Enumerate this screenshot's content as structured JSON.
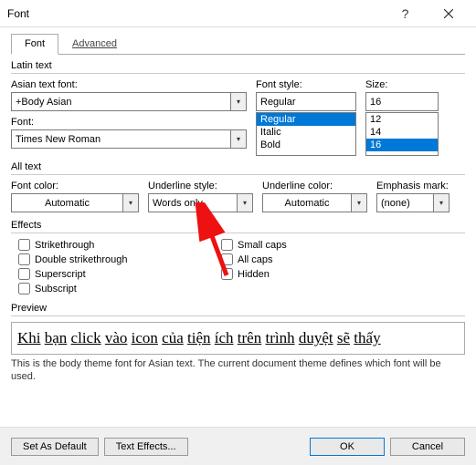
{
  "window": {
    "title": "Font"
  },
  "tabs": {
    "font": "Font",
    "advanced": "Advanced"
  },
  "latin": {
    "group": "Latin text",
    "asian_label": "Asian text font:",
    "asian_value": "+Body Asian",
    "font_label": "Font:",
    "font_value": "Times New Roman",
    "style_label": "Font style:",
    "style_value": "Regular",
    "style_options": [
      "Regular",
      "Italic",
      "Bold"
    ],
    "size_label": "Size:",
    "size_value": "16",
    "size_options": [
      "12",
      "14",
      "16"
    ]
  },
  "alltext": {
    "group": "All text",
    "fontcolor_label": "Font color:",
    "fontcolor_value": "Automatic",
    "underline_label": "Underline style:",
    "underline_value": "Words only",
    "ucolor_label": "Underline color:",
    "ucolor_value": "Automatic",
    "emphasis_label": "Emphasis mark:",
    "emphasis_value": "(none)"
  },
  "effects": {
    "group": "Effects",
    "strike": "Strikethrough",
    "dstrike": "Double strikethrough",
    "superscript": "Superscript",
    "subscript": "Subscript",
    "smallcaps": "Small caps",
    "allcaps": "All caps",
    "hidden": "Hidden"
  },
  "preview": {
    "group": "Preview",
    "words": [
      "Khi",
      "bạn",
      "click",
      "vào",
      "icon",
      "của",
      "tiện",
      "ích",
      "trên",
      "trình",
      "duyệt",
      "sẽ",
      "thấy"
    ],
    "note": "This is the body theme font for Asian text. The current document theme defines which font will be used."
  },
  "footer": {
    "setdefault": "Set As Default",
    "texteffects": "Text Effects...",
    "ok": "OK",
    "cancel": "Cancel"
  }
}
